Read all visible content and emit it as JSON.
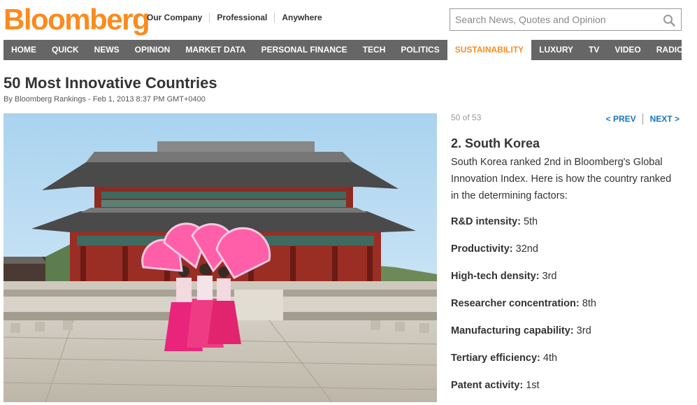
{
  "header": {
    "logo": "Bloomberg",
    "links": [
      "Our Company",
      "Professional",
      "Anywhere"
    ],
    "search_placeholder": "Search News, Quotes and Opinion",
    "brand_color": "#fb8b1e"
  },
  "nav": {
    "items": [
      "HOME",
      "QUICK",
      "NEWS",
      "OPINION",
      "MARKET DATA",
      "PERSONAL FINANCE",
      "TECH",
      "POLITICS",
      "SUSTAINABILITY",
      "LUXURY",
      "TV",
      "VIDEO",
      "RADIO"
    ],
    "active": "SUSTAINABILITY"
  },
  "article": {
    "title": "50 Most Innovative Countries",
    "byline": "By Bloomberg Rankings - Feb 1, 2013 8:37 PM GMT+0400"
  },
  "slide": {
    "counter": "50 of 53",
    "prev_label": "< PREV",
    "next_label": "NEXT >",
    "heading": "2. South Korea",
    "description": "South Korea ranked 2nd in Bloomberg's Global Innovation Index. Here is how the country ranked in the determining factors:",
    "factors": [
      {
        "label": "R&D intensity:",
        "value": "5th"
      },
      {
        "label": "Productivity:",
        "value": "32nd"
      },
      {
        "label": "High-tech density:",
        "value": "3rd"
      },
      {
        "label": "Researcher concentration:",
        "value": "8th"
      },
      {
        "label": "Manufacturing capability:",
        "value": "3rd"
      },
      {
        "label": "Tertiary efficiency:",
        "value": "4th"
      },
      {
        "label": "Patent activity:",
        "value": "1st"
      }
    ]
  }
}
